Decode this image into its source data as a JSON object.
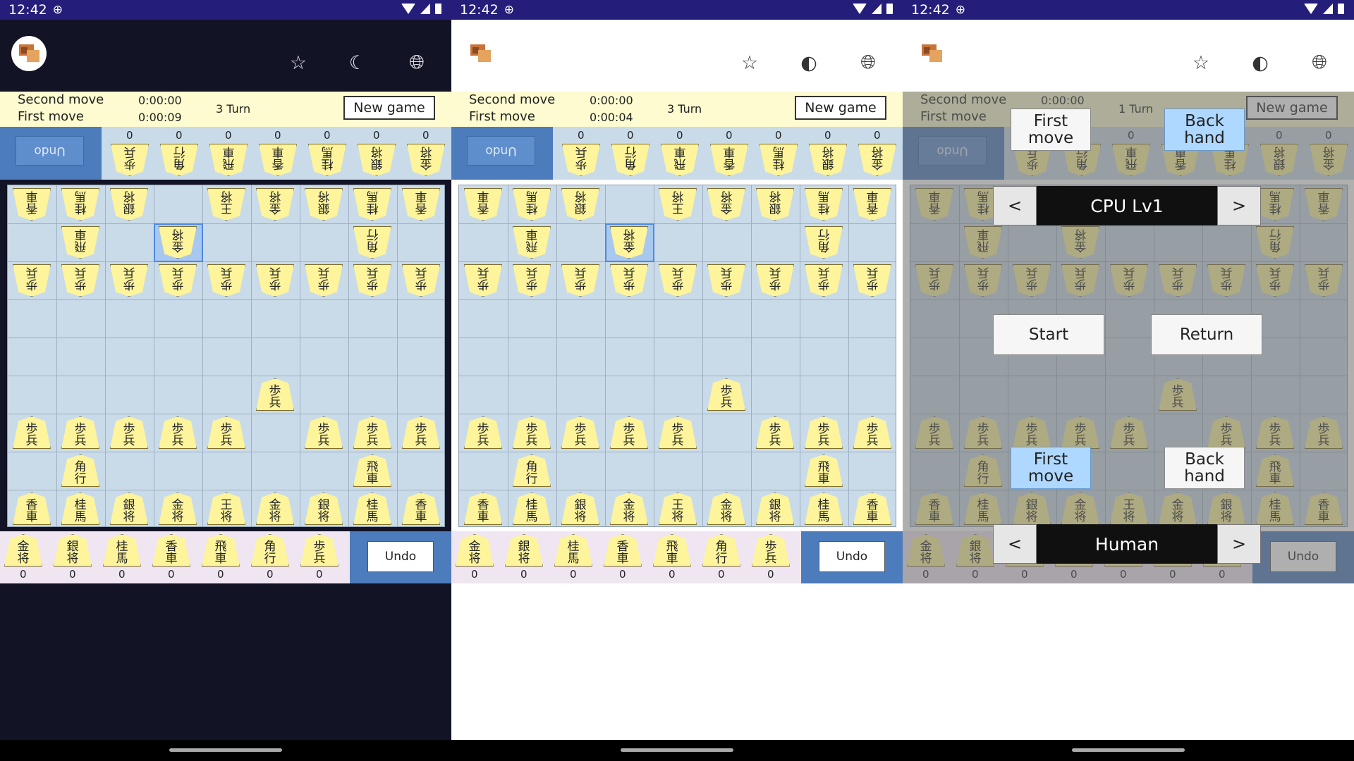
{
  "status": {
    "time": "12:42"
  },
  "info": {
    "second_move_label": "Second move",
    "first_move_label": "First move",
    "panels": [
      {
        "second_time": "0:00:00",
        "first_time": "0:00:09",
        "turn": "3 Turn"
      },
      {
        "second_time": "0:00:00",
        "first_time": "0:00:04",
        "turn": "3 Turn"
      },
      {
        "second_time": "0:00:00",
        "first_time": "",
        "turn": "1 Turn"
      }
    ],
    "new_game_label": "New game"
  },
  "undo_label": "Undo",
  "hand_counts": [
    "0",
    "0",
    "0",
    "0",
    "0",
    "0",
    "0"
  ],
  "dialog": {
    "first_move_label": "First move",
    "back_hand_label": "Back hand",
    "start_label": "Start",
    "return_label": "Return",
    "prev_label": "<",
    "next_label": ">",
    "opponent_value": "CPU Lv1",
    "player_value": "Human"
  },
  "pieces": {
    "fu": [
      "歩",
      "兵"
    ],
    "kyo": [
      "香",
      "車"
    ],
    "kei": [
      "桂",
      "馬"
    ],
    "gin": [
      "銀",
      "将"
    ],
    "kin": [
      "金",
      "将"
    ],
    "gyoku": [
      "王",
      "将"
    ],
    "hisha": [
      "飛",
      "車"
    ],
    "kaku": [
      "角",
      "行"
    ]
  },
  "hand_order": [
    "kin",
    "gin",
    "kei",
    "kyo",
    "hisha",
    "kaku",
    "fu"
  ],
  "board": [
    [
      "kyo^",
      "kei^",
      "gin^",
      "",
      "gyoku^",
      "kin^",
      "gin^",
      "kei^",
      "kyo^"
    ],
    [
      "",
      "hisha^",
      "",
      "kin^",
      "",
      "",
      "",
      "kaku^",
      ""
    ],
    [
      "fu^",
      "fu^",
      "fu^",
      "fu^",
      "fu^",
      "fu^",
      "fu^",
      "fu^",
      "fu^"
    ],
    [
      "",
      "",
      "",
      "",
      "",
      "",
      "",
      "",
      ""
    ],
    [
      "",
      "",
      "",
      "",
      "",
      "",
      "",
      "",
      ""
    ],
    [
      "",
      "",
      "",
      "",
      "",
      "fu",
      "",
      "",
      ""
    ],
    [
      "fu",
      "fu",
      "fu",
      "fu",
      "fu",
      "",
      "fu",
      "fu",
      "fu"
    ],
    [
      "",
      "kaku",
      "",
      "",
      "",
      "",
      "",
      "hisha",
      ""
    ],
    [
      "kyo",
      "kei",
      "gin",
      "kin",
      "gyoku",
      "kin",
      "gin",
      "kei",
      "kyo"
    ]
  ]
}
